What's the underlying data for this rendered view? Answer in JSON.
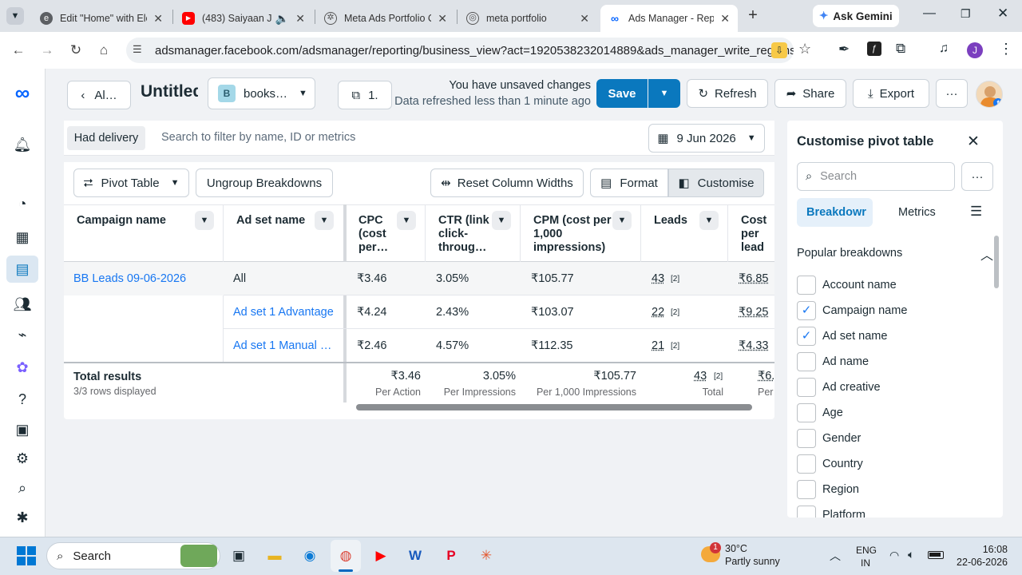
{
  "browser": {
    "tabs": [
      {
        "title": "Edit \"Home\" with Ele",
        "icon": "elementor-icon"
      },
      {
        "title": "(483) Saiyaan Ji",
        "icon": "youtube-icon"
      },
      {
        "title": "Meta Ads Portfolio C",
        "icon": "chatgpt-icon"
      },
      {
        "title": "meta portfolio",
        "icon": "globe-icon"
      },
      {
        "title": "Ads Manager - Repo",
        "icon": "meta-icon"
      }
    ],
    "new_tab": "+",
    "gemini": "Ask Gemini",
    "url": "adsmanager.facebook.com/adsmanager/reporting/business_view?act=1920538232014889&ads_manager_write_regions=…",
    "profile_initial": "J"
  },
  "header": {
    "back_label": "Al…",
    "title": "Untitled",
    "account_badge": "B",
    "account_name": "books…",
    "copies_label": "1.",
    "unsaved": "You have unsaved changes",
    "refreshed": "Data refreshed less than 1 minute ago",
    "save": "Save",
    "refresh": "Refresh",
    "share": "Share",
    "export": "Export",
    "more": "···"
  },
  "filter": {
    "chip": "Had delivery",
    "placeholder": "Search to filter by name, ID or metrics",
    "date": "9 Jun 2026"
  },
  "toolbar": {
    "pivot": "Pivot Table",
    "ungroup": "Ungroup Breakdowns",
    "reset": "Reset Column Widths",
    "format": "Format",
    "customise": "Customise"
  },
  "table": {
    "headers": {
      "campaign": "Campaign name",
      "adset": "Ad set name",
      "cpc": "CPC (cost per…",
      "ctr": "CTR (link click-throug…",
      "cpm": "CPM (cost per 1,000 impressions)",
      "leads": "Leads",
      "cpl": "Cost per lead"
    },
    "rows": [
      {
        "campaign": "BB Leads 09-06-2026",
        "adset": "All",
        "cpc": "₹3.46",
        "ctr": "3.05%",
        "cpm": "₹105.77",
        "leads": "43",
        "leads_note": "[2]",
        "cpl": "₹6.85"
      },
      {
        "campaign": "",
        "adset": "Ad set 1 Advantage",
        "cpc": "₹4.24",
        "ctr": "2.43%",
        "cpm": "₹103.07",
        "leads": "22",
        "leads_note": "[2]",
        "cpl": "₹9.25"
      },
      {
        "campaign": "",
        "adset": "Ad set 1 Manual …",
        "cpc": "₹2.46",
        "ctr": "4.57%",
        "cpm": "₹112.35",
        "leads": "21",
        "leads_note": "[2]",
        "cpl": "₹4.33"
      }
    ],
    "total": {
      "label": "Total results",
      "rows_displayed": "3/3 rows displayed",
      "cpc": "₹3.46",
      "cpc_sub": "Per Action",
      "ctr": "3.05%",
      "ctr_sub": "Per Impressions",
      "cpm": "₹105.77",
      "cpm_sub": "Per 1,000 Impressions",
      "leads": "43",
      "leads_note": "[2]",
      "leads_sub": "Total",
      "cpl": "₹6.",
      "cpl_sub": "Per"
    }
  },
  "panel": {
    "title": "Customise pivot table",
    "search_placeholder": "Search",
    "tab_breakdown": "Breakdowr",
    "tab_metrics": "Metrics",
    "section": "Popular breakdowns",
    "items": [
      {
        "label": "Account name",
        "checked": false
      },
      {
        "label": "Campaign name",
        "checked": true
      },
      {
        "label": "Ad set name",
        "checked": true
      },
      {
        "label": "Ad name",
        "checked": false
      },
      {
        "label": "Ad creative",
        "checked": false
      },
      {
        "label": "Age",
        "checked": false
      },
      {
        "label": "Gender",
        "checked": false
      },
      {
        "label": "Country",
        "checked": false
      },
      {
        "label": "Region",
        "checked": false
      },
      {
        "label": "Platform",
        "checked": false
      }
    ]
  },
  "taskbar": {
    "search": "Search",
    "weather_temp": "30°C",
    "weather_desc": "Partly sunny",
    "weather_badge": "1",
    "lang1": "ENG",
    "lang2": "IN",
    "time": "16:08",
    "date": "22-06-2026"
  },
  "colors": {
    "accent": "#0a78be",
    "link": "#1877f2"
  }
}
